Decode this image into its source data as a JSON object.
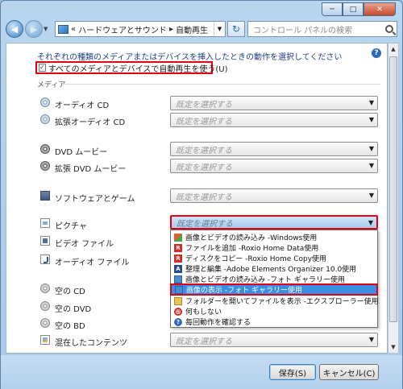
{
  "window": {
    "minimize_label": "─",
    "maximize_label": "□",
    "close_label": "✕"
  },
  "nav": {
    "back_label": "◀",
    "forward_label": "▶",
    "breadcrumb_prefix": "«",
    "breadcrumb_1": "ハードウェアとサウンド",
    "breadcrumb_sep": "▸",
    "breadcrumb_2": "自動再生",
    "refresh_label": "↻",
    "search_placeholder": "コントロール パネルの検索"
  },
  "intro_text": "それぞれの種類のメディアまたはデバイスを挿入したときの動作を選択してください",
  "use_autoplay": {
    "checked": true,
    "check_mark": "✓",
    "label": "すべてのメディアとデバイスで自動再生を使う(U)"
  },
  "media_section_label": "メディア",
  "select_placeholder": "既定を選択する",
  "media_rows": [
    {
      "label": "オーディオ CD",
      "icon": "cd-icon"
    },
    {
      "label": "拡張オーディオ CD",
      "icon": "cd-icon"
    },
    {
      "label": "DVD ムービー",
      "icon": "dvd-icon"
    },
    {
      "label": "拡張 DVD ムービー",
      "icon": "dvd-icon"
    },
    {
      "label": "ソフトウェアとゲーム",
      "icon": "app-icon"
    },
    {
      "label": "ピクチャ",
      "icon": "picture-icon"
    },
    {
      "label": "ビデオ ファイル",
      "icon": "video-icon"
    },
    {
      "label": "オーディオ ファイル",
      "icon": "audio-icon"
    },
    {
      "label": "空の CD",
      "icon": "blank-cd-icon"
    },
    {
      "label": "空の DVD",
      "icon": "blank-dvd-icon"
    },
    {
      "label": "空の BD",
      "icon": "blank-bd-icon"
    },
    {
      "label": "混在したコンテンツ",
      "icon": "mixed-content-icon"
    }
  ],
  "dropdown_items": [
    {
      "label": "画像とビデオの読み込み -Windows使用",
      "icon": "windows-icon"
    },
    {
      "label": "ファイルを追加 -Roxio Home Data使用",
      "icon": "roxio-icon",
      "glyph": "R"
    },
    {
      "label": "ディスクをコピー -Roxio Home Copy使用",
      "icon": "roxio-icon",
      "glyph": "R"
    },
    {
      "label": "整理と編集 -Adobe Elements Organizer 10.0使用",
      "icon": "adobe-icon",
      "glyph": "A"
    },
    {
      "label": "画像とビデオの読み込み -フォト ギャラリー使用",
      "icon": "photo-gallery-icon"
    },
    {
      "label": "画像の表示 -フォト ギャラリー使用",
      "icon": "photo-gallery-icon",
      "selected": true
    },
    {
      "label": "フォルダーを開いてファイルを表示 -エクスプローラー使用",
      "icon": "folder-icon"
    },
    {
      "label": "何もしない",
      "icon": "prohibited-icon",
      "glyph": "⊘"
    },
    {
      "label": "毎回動作を確認する",
      "icon": "question-icon",
      "glyph": "?"
    }
  ],
  "help_glyph": "?",
  "buttons": {
    "save": "保存(S)",
    "cancel": "キャンセル(C)"
  },
  "colors": {
    "highlight_border": "#e00010",
    "selection_bg": "#3a8ee6",
    "intro_text": "#1e3d8c"
  }
}
